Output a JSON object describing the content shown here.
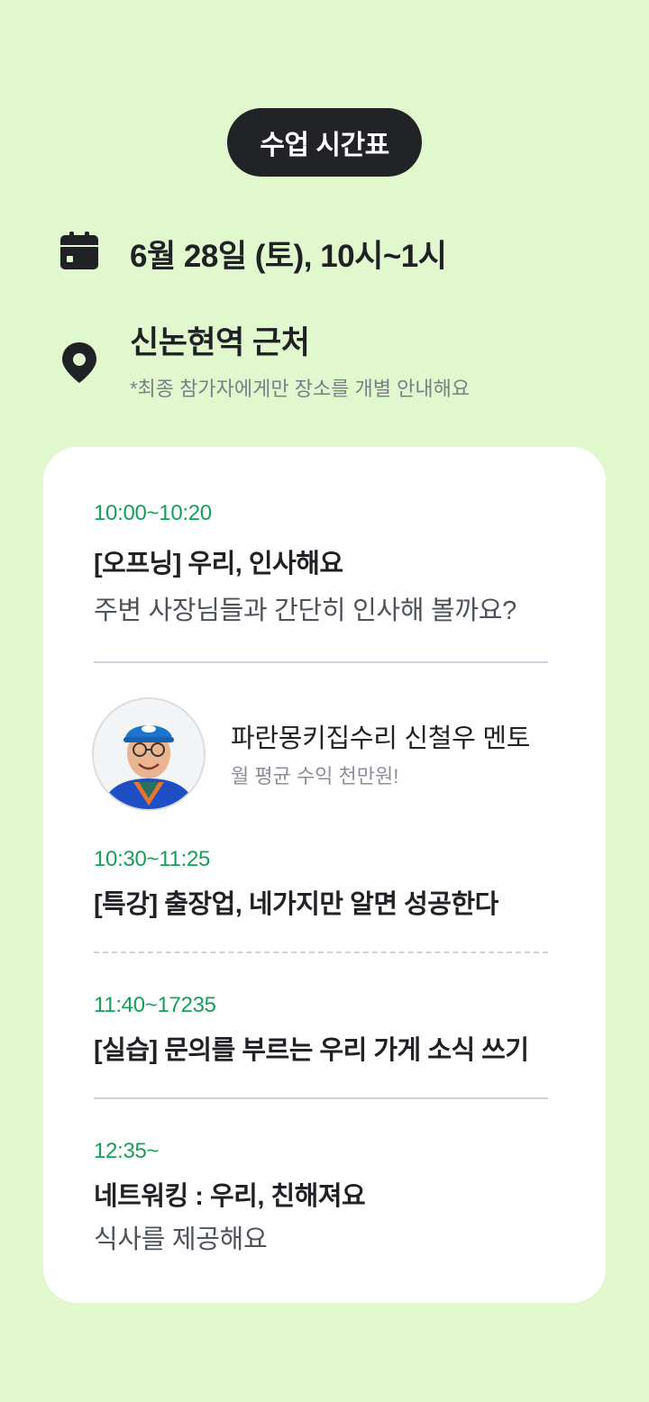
{
  "header": {
    "pill_label": "수업 시간표"
  },
  "event": {
    "date_icon": "calendar-icon",
    "date_text": "6월 28일 (토), 10시~1시",
    "location_icon": "map-pin-icon",
    "location_title": "신논현역 근처",
    "location_note": "*최종 참가자에게만 장소를 개별 안내해요"
  },
  "schedule": {
    "opening": {
      "time": "10:00~10:20",
      "title": "[오프닝] 우리, 인사해요",
      "desc": "주변 사장님들과 간단히 인사해 볼까요?"
    },
    "mentor": {
      "name": "파란몽키집수리 신철우 멘토",
      "subtitle": "월 평균 수익 천만원!"
    },
    "lecture": {
      "time": "10:30~11:25",
      "title": "[특강] 출장업, 네가지만 알면 성공한다"
    },
    "practice": {
      "time": "11:40~17235",
      "title": "[실습] 문의를 부르는 우리 가게 소식 쓰기"
    },
    "networking": {
      "time": "12:35~",
      "title": "네트워킹 : 우리, 친해져요",
      "desc": "식사를 제공해요"
    }
  },
  "colors": {
    "background": "#e1f8cf",
    "time_accent": "#14a05a",
    "pill_bg": "#222326"
  }
}
